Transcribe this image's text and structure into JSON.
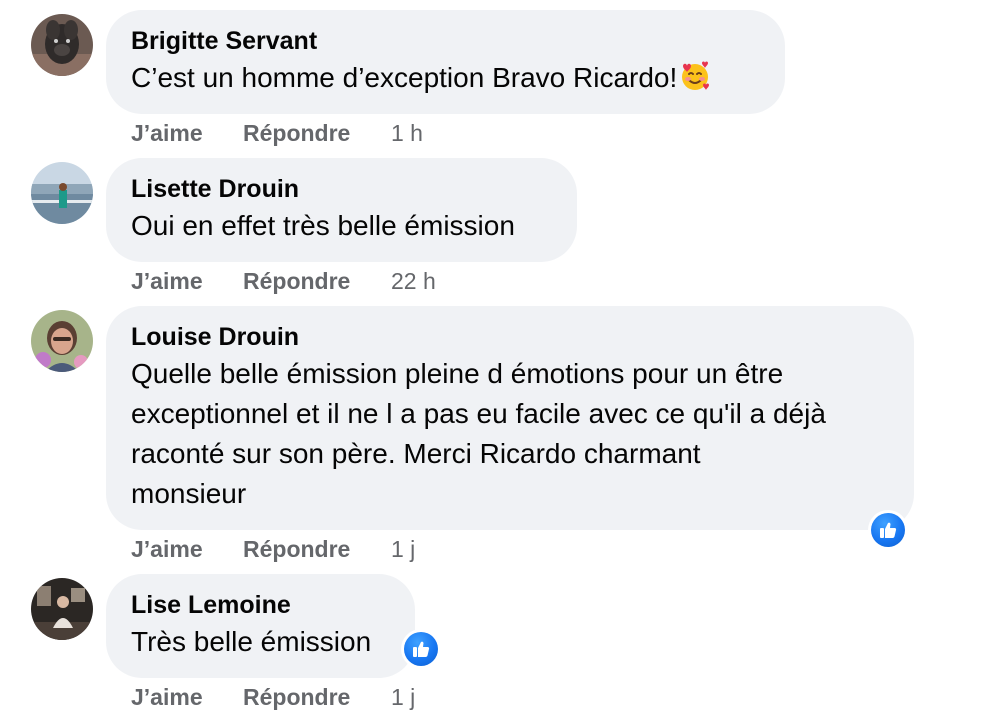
{
  "comments": [
    {
      "author": "Brigitte Servant",
      "lines": [
        "C’est un homme d’exception Bravo Ricardo!"
      ],
      "emoji": "smiling-face-with-hearts",
      "actions": {
        "like": "J’aime",
        "reply": "Répondre",
        "time": "1 h"
      },
      "avatar": "avatar-dog-icon"
    },
    {
      "author": "Lisette Drouin",
      "lines": [
        "Oui en effet très belle émission"
      ],
      "actions": {
        "like": "J’aime",
        "reply": "Répondre",
        "time": "22 h"
      },
      "avatar": "avatar-landscape-icon"
    },
    {
      "author": "Louise Drouin",
      "lines": [
        "Quelle belle émission pleine d émotions pour un être",
        "exceptionnel et il ne l a pas eu facile avec ce qu'il a déjà",
        "raconté sur son père. Merci Ricardo charmant",
        "monsieur"
      ],
      "reaction": "like-icon",
      "actions": {
        "like": "J’aime",
        "reply": "Répondre",
        "time": "1 j"
      },
      "avatar": "avatar-portrait-icon"
    },
    {
      "author": "Lise Lemoine",
      "lines": [
        "Très belle émission"
      ],
      "reaction": "like-icon",
      "actions": {
        "like": "J’aime",
        "reply": "Répondre",
        "time": "1 j"
      },
      "avatar": "avatar-room-icon"
    }
  ],
  "colors": {
    "bubble": "#f0f2f5",
    "secondary_text": "#65676b",
    "like_blue": "#1877f2"
  }
}
